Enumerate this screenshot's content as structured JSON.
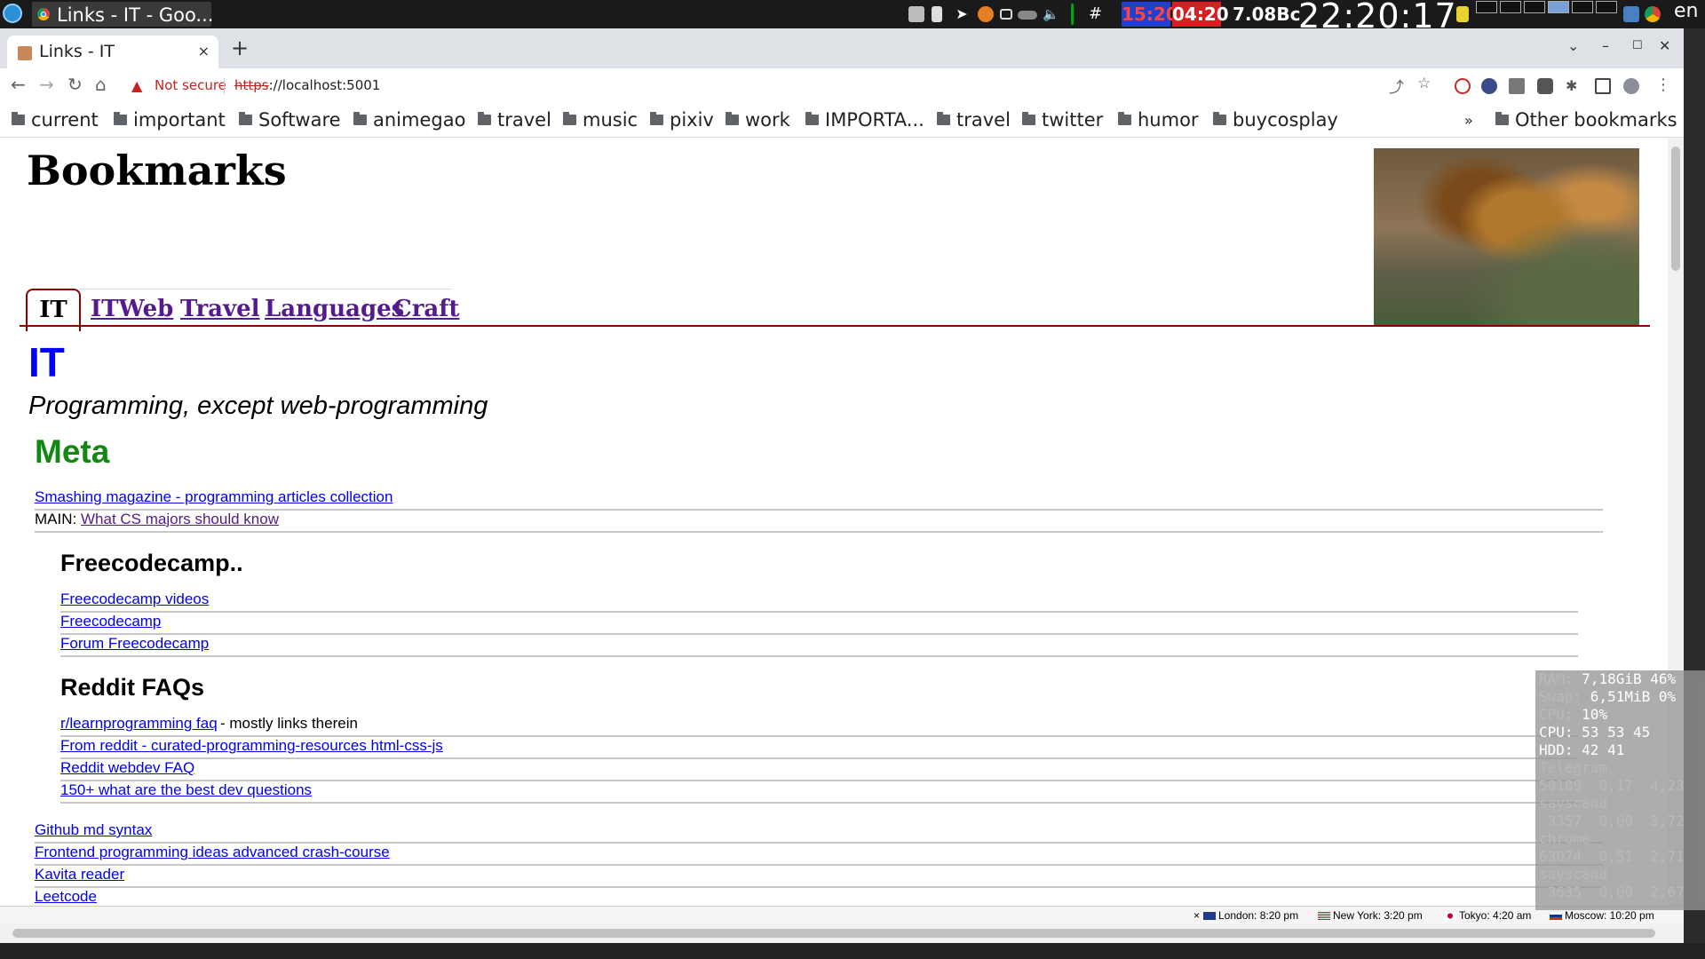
{
  "os": {
    "taskbar_title": "Links - IT - Goo...",
    "clock_a": "15:20",
    "clock_b": "04:20",
    "mem": "7.08Bc",
    "time": "22:20:17",
    "lang": "en"
  },
  "browser": {
    "tab_title": "Links - IT",
    "tab_close": "×",
    "new_tab": "+",
    "not_secure": "Not secure",
    "url_scheme": "https",
    "url_rest": "://localhost:5001",
    "bookmarks": [
      "current",
      "important",
      "Software",
      "animegao",
      "travel",
      "music",
      "pixiv",
      "work",
      "IMPORTA...",
      "travel",
      "twitter",
      "humor",
      "buycosplay"
    ],
    "bookmarks_more": "»",
    "other_bookmarks": "Other bookmarks"
  },
  "page": {
    "heading": "Bookmarks",
    "tabs": {
      "active": "IT",
      "items": [
        "ITWeb",
        "Travel",
        "Languages",
        "Craft"
      ]
    },
    "section_title": "IT",
    "section_subtitle": "Programming, except web-programming",
    "meta_heading": "Meta",
    "meta_links": {
      "l1": "Smashing magazine - programming articles collection",
      "main_prefix": "MAIN:",
      "l2": "What CS majors should know"
    },
    "freecodecamp": {
      "heading": "Freecodecamp..",
      "links": [
        "Freecodecamp videos",
        "Freecodecamp",
        "Forum Freecodecamp"
      ]
    },
    "reddit": {
      "heading": "Reddit FAQs",
      "l1": "r/learnprogramming faq",
      "l1_suffix": " - mostly links therein",
      "l2": "From reddit - curated-programming-resources html-css-js",
      "l3": "Reddit webdev FAQ",
      "l4": "150+ what are the best dev questions"
    },
    "more_links": [
      "Github md syntax",
      "Frontend programming ideas advanced crash-course",
      "Kavita reader",
      "Leetcode"
    ]
  },
  "monitor": {
    "lines": [
      {
        "label": "RAM: ",
        "value": "7,18GiB 46%"
      },
      {
        "label": "Swap: ",
        "value": "6,51MiB 0%"
      },
      {
        "label": "CPU: ",
        "value": "10%"
      },
      {
        "label": "",
        "value": "CPU: 53 53 45"
      },
      {
        "label": "",
        "value": "HDD: 42 41"
      },
      {
        "label": "Telegram",
        "value": ""
      },
      {
        "label": "50109  0,17  4,23",
        "value": ""
      },
      {
        "label": "sayscand",
        "value": ""
      },
      {
        "label": " 3357  0,00  3,72",
        "value": ""
      },
      {
        "label": "chrome",
        "value": ""
      },
      {
        "label": "63074  0,51  2,71",
        "value": ""
      },
      {
        "label": "sayscand",
        "value": ""
      },
      {
        "label": " 3635  0,00  2,67",
        "value": ""
      }
    ]
  },
  "statusbar": {
    "close": "×",
    "london": "London: 8:20 pm",
    "newyork": "New York: 3:20 pm",
    "tokyo": "Tokyo: 4:20 am",
    "moscow": "Moscow: 10:20 pm"
  },
  "colors": {
    "tab_border": "#8b0000",
    "section_title": "#0000ff",
    "meta": "#118811",
    "link": "#0000ee",
    "visited": "#551a8b"
  }
}
